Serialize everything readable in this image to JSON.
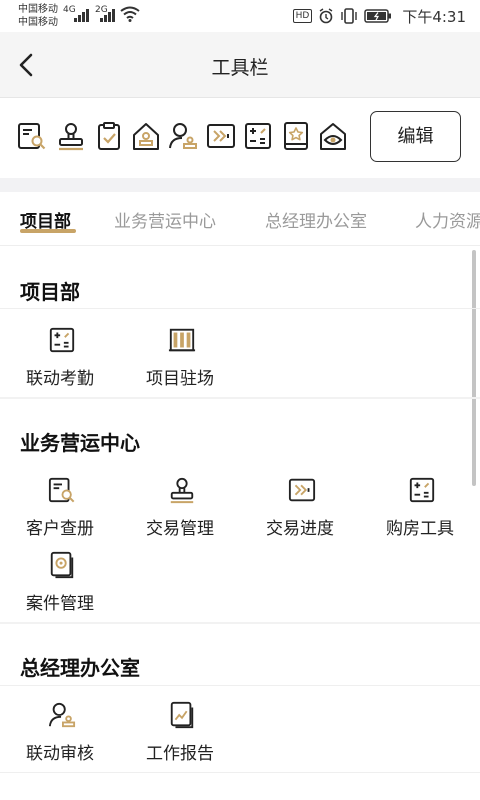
{
  "status_bar": {
    "carrier1": "中国移动",
    "carrier2": "中国移动",
    "net1": "4G",
    "net2": "2G",
    "hd": "HD",
    "time": "下午4:31"
  },
  "header": {
    "title": "工具栏"
  },
  "toolbar": {
    "icons": [
      "customer-search-icon",
      "stamp-icon",
      "clipboard-check-icon",
      "house-stamp-icon",
      "user-stamp-icon",
      "progress-icon",
      "calculator-icon",
      "star-book-icon",
      "eye-icon"
    ],
    "edit_label": "编辑"
  },
  "tabs": [
    {
      "label": "项目部"
    },
    {
      "label": "业务营运中心"
    },
    {
      "label": "总经理办公室"
    },
    {
      "label": "人力资源"
    }
  ],
  "sections": [
    {
      "title": "项目部",
      "items": [
        {
          "label": "联动考勤",
          "icon": "calculator-icon"
        },
        {
          "label": "项目驻场",
          "icon": "building-icon"
        }
      ]
    },
    {
      "title": "业务营运中心",
      "items": [
        {
          "label": "客户查册",
          "icon": "customer-search-icon"
        },
        {
          "label": "交易管理",
          "icon": "stamp-icon"
        },
        {
          "label": "交易进度",
          "icon": "progress-icon"
        },
        {
          "label": "购房工具",
          "icon": "calculator-icon"
        },
        {
          "label": "案件管理",
          "icon": "case-icon"
        }
      ]
    },
    {
      "title": "总经理办公室",
      "items": [
        {
          "label": "联动审核",
          "icon": "user-stamp-icon"
        },
        {
          "label": "工作报告",
          "icon": "report-icon"
        }
      ]
    }
  ],
  "colors": {
    "accent": "#c8a467",
    "text": "#222222",
    "inactive_tab": "#9a9a9a"
  }
}
